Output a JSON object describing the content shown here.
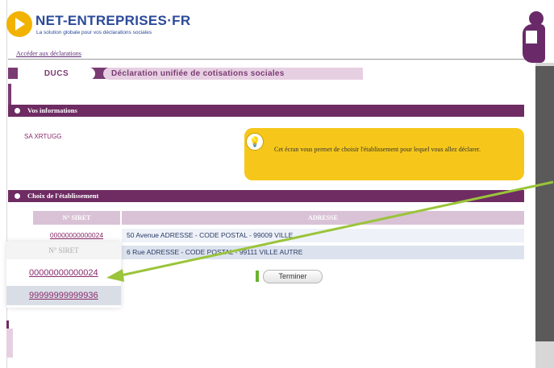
{
  "header": {
    "brand": "NET-ENTREPRISES·FR",
    "tagline": "La solution globale pour vos déclarations sociales",
    "access_link": "Accéder aux déclarations"
  },
  "tabs": {
    "ducs": "DUCS",
    "title": "Déclaration unifiée de cotisations sociales"
  },
  "section_info": {
    "title": "Vos informations",
    "company": "SA XRTUGG",
    "info_text": "Cet écran vous permet de choisir l'établissement pour lequel vous allez déclarer."
  },
  "section_choice": {
    "title": "Choix de l'établissement",
    "columns": [
      "N° SIRET",
      "ADRESSE"
    ],
    "rows": [
      {
        "siret": "00000000000024",
        "address": "50 Avenue ADRESSE - CODE POSTAL - 99009 VILLE"
      },
      {
        "siret": "99999999999936",
        "address": "6 Rue ADRESSE - CODE POSTAL - 99111 VILLE AUTRE"
      }
    ]
  },
  "zoom": {
    "header": "N° SIRET",
    "rows": [
      "00000000000024",
      "99999999999936"
    ]
  },
  "buttons": {
    "finish": "Terminer"
  },
  "colors": {
    "brand_purple": "#6e2c63",
    "accent_yellow": "#f6c71a",
    "arrow_green": "#9ac43a"
  }
}
